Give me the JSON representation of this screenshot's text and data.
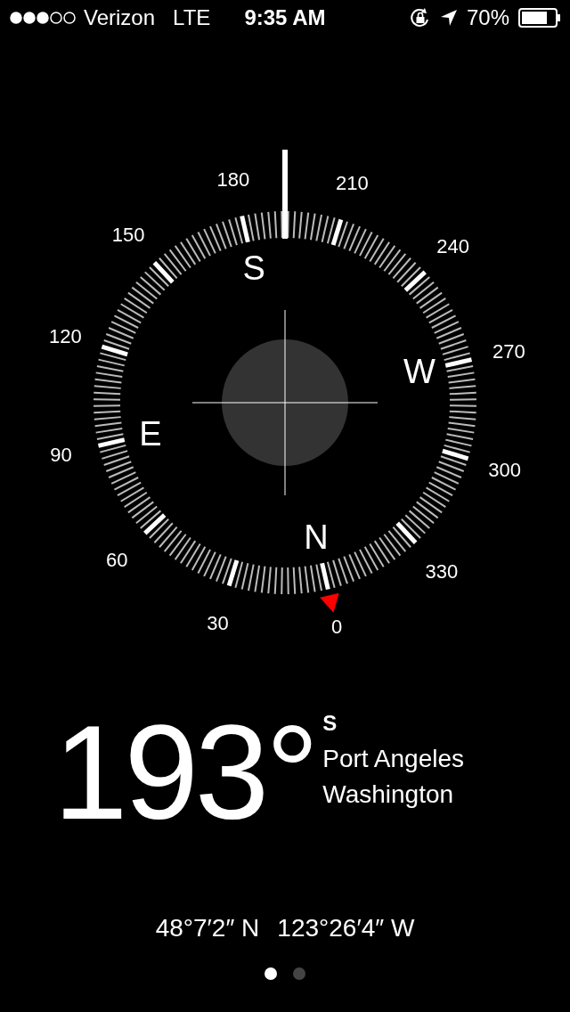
{
  "status_bar": {
    "carrier": "Verizon",
    "network": "LTE",
    "time": "9:35 AM",
    "battery": "70%"
  },
  "dial": {
    "labels": [
      "0",
      "30",
      "60",
      "90",
      "120",
      "150",
      "180",
      "210",
      "240",
      "270",
      "300",
      "330"
    ],
    "cardinals": [
      "N",
      "E",
      "S",
      "W"
    ]
  },
  "heading": {
    "degrees": "193°",
    "direction": "S",
    "city": "Port Angeles",
    "region": "Washington"
  },
  "coordinates": {
    "latitude": "48°7′2″ N",
    "longitude": "123°26′4″ W"
  },
  "page_dots": [
    {
      "selected": true
    },
    {
      "selected": false
    }
  ]
}
